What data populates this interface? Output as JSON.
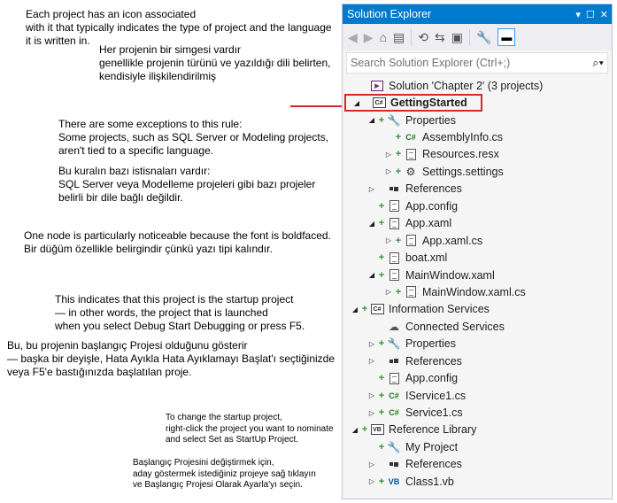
{
  "notes": [
    {
      "id": "icon-en",
      "lines": [
        "Each project has an icon associated",
        "with it that typically indicates the type of project and the language",
        "it is written in."
      ]
    },
    {
      "id": "icon-tr",
      "lines": [
        "Her projenin bir simgesi vardır",
        "genellikle projenin türünü ve yazıldığı dili belirten,",
        "kendisiyle ilişkilendirilmiş"
      ]
    },
    {
      "id": "exc-en",
      "lines": [
        "There are some exceptions to this rule:",
        "Some projects, such as SQL Server or Modeling projects,",
        "aren't tied to a specific language."
      ]
    },
    {
      "id": "exc-tr",
      "lines": [
        "Bu kuralın bazı istisnaları vardır:",
        "SQL Server veya Modelleme projeleri gibi bazı projeler",
        "belirli bir dile bağlı değildir."
      ]
    },
    {
      "id": "bold-en-tr",
      "lines": [
        "One node is particularly noticeable because the font is boldfaced.",
        "Bir düğüm özellikle belirgindir çünkü yazı tipi kalındır."
      ]
    },
    {
      "id": "startup-en",
      "lines": [
        "This indicates that this project is the startup project",
        "— in other words, the project that is launched",
        "when you select Debug Start Debugging or press F5."
      ]
    },
    {
      "id": "startup-tr",
      "lines": [
        "Bu, bu projenin başlangıç Projesi olduğunu gösterir",
        "— başka bir deyişle, Hata Ayıkla Hata Ayıklamayı Başlat'ı seçtiğinizde",
        "veya F5'e bastığınızda başlatılan proje."
      ]
    },
    {
      "id": "change-en",
      "lines": [
        "To change the startup project,",
        "right-click the project you want to nominate",
        "and select Set as StartUp Project."
      ]
    },
    {
      "id": "change-tr",
      "lines": [
        "Başlangıç Projesini değiştirmek için,",
        "aday göstermek istediğiniz projeye sağ tıklayın",
        "ve Başlangıç Projesi Olarak Ayarla'yı seçin."
      ]
    }
  ],
  "explorer": {
    "title": "Solution Explorer",
    "title_controls": [
      "▾",
      "☐",
      "✕"
    ],
    "search_placeholder": "Search Solution Explorer (Ctrl+;)",
    "search_icon": "⌕▾",
    "tree": [
      {
        "label": "Solution 'Chapter 2' (3 projects)",
        "icon": "solution-icon",
        "depth": 0,
        "expander": "",
        "plus": ""
      },
      {
        "label": "GettingStarted",
        "icon": "csharp-project-icon",
        "depth": 0,
        "expander": "◢",
        "plus": "",
        "bold": true,
        "selected": true
      },
      {
        "label": "Properties",
        "icon": "wrench-icon",
        "depth": 1,
        "expander": "◢",
        "plus": "+"
      },
      {
        "label": "AssemblyInfo.cs",
        "icon": "csharp-file-icon",
        "depth": 2,
        "expander": "",
        "plus": "+"
      },
      {
        "label": "Resources.resx",
        "icon": "resource-file-icon",
        "depth": 2,
        "expander": "▷",
        "plus": "+"
      },
      {
        "label": "Settings.settings",
        "icon": "gear-icon",
        "depth": 2,
        "expander": "▷",
        "plus": "+"
      },
      {
        "label": "References",
        "icon": "references-icon",
        "depth": 1,
        "expander": "▷",
        "plus": ""
      },
      {
        "label": "App.config",
        "icon": "config-file-icon",
        "depth": 1,
        "expander": "",
        "plus": "+"
      },
      {
        "label": "App.xaml",
        "icon": "xaml-file-icon",
        "depth": 1,
        "expander": "◢",
        "plus": "+"
      },
      {
        "label": "App.xaml.cs",
        "icon": "xaml-file-icon",
        "depth": 2,
        "expander": "▷",
        "plus": "+"
      },
      {
        "label": "boat.xml",
        "icon": "xml-file-icon",
        "depth": 1,
        "expander": "",
        "plus": "+"
      },
      {
        "label": "MainWindow.xaml",
        "icon": "xaml-file-icon",
        "depth": 1,
        "expander": "◢",
        "plus": "+"
      },
      {
        "label": "MainWindow.xaml.cs",
        "icon": "xaml-file-icon",
        "depth": 2,
        "expander": "▷",
        "plus": "+"
      },
      {
        "label": "Information Services",
        "icon": "csharp-project-icon",
        "depth": 0,
        "expander": "◢",
        "plus": "+"
      },
      {
        "label": "Connected Services",
        "icon": "cloud-icon",
        "depth": 1,
        "expander": "",
        "plus": ""
      },
      {
        "label": "Properties",
        "icon": "wrench-icon",
        "depth": 1,
        "expander": "▷",
        "plus": "+"
      },
      {
        "label": "References",
        "icon": "references-icon",
        "depth": 1,
        "expander": "▷",
        "plus": ""
      },
      {
        "label": "App.config",
        "icon": "config-file-icon",
        "depth": 1,
        "expander": "",
        "plus": "+"
      },
      {
        "label": "IService1.cs",
        "icon": "csharp-file-icon",
        "depth": 1,
        "expander": "▷",
        "plus": "+"
      },
      {
        "label": "Service1.cs",
        "icon": "csharp-file-icon",
        "depth": 1,
        "expander": "▷",
        "plus": "+"
      },
      {
        "label": "Reference Library",
        "icon": "vb-project-icon",
        "depth": 0,
        "expander": "◢",
        "plus": "+"
      },
      {
        "label": "My Project",
        "icon": "wrench-icon",
        "depth": 1,
        "expander": "",
        "plus": "+"
      },
      {
        "label": "References",
        "icon": "references-icon",
        "depth": 1,
        "expander": "▷",
        "plus": ""
      },
      {
        "label": "Class1.vb",
        "icon": "vb-file-icon",
        "depth": 1,
        "expander": "▷",
        "plus": "+"
      }
    ]
  }
}
